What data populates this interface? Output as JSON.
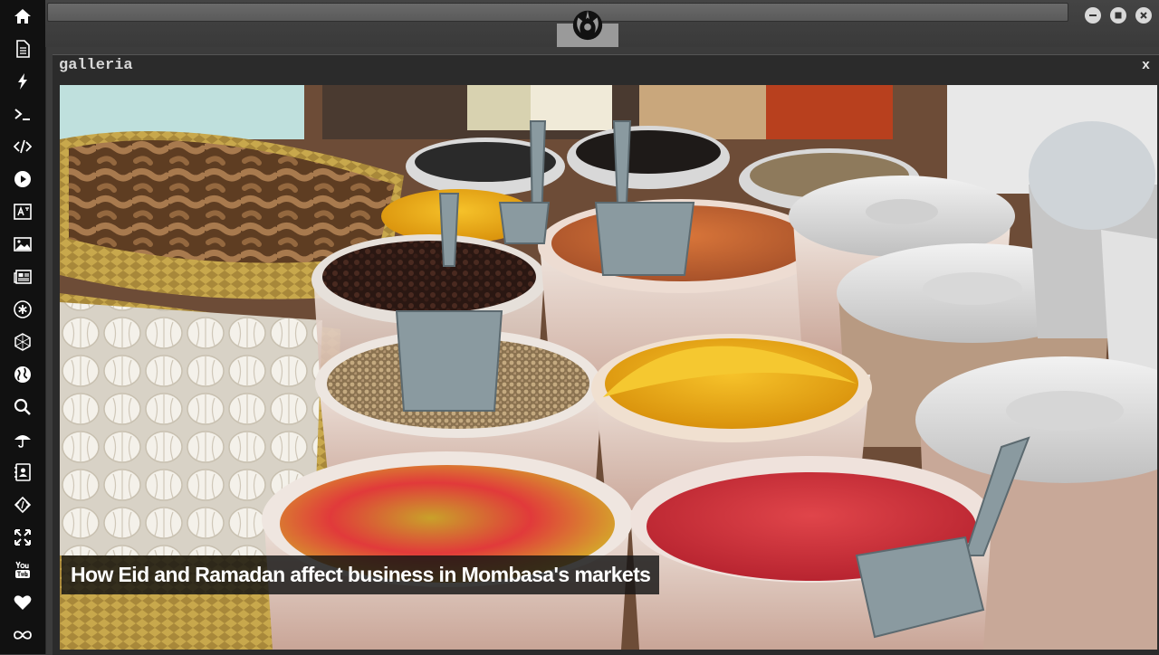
{
  "sidebar": {
    "items": [
      {
        "icon": "home-icon"
      },
      {
        "icon": "document-icon"
      },
      {
        "icon": "lightning-icon"
      },
      {
        "icon": "terminal-icon"
      },
      {
        "icon": "code-icon"
      },
      {
        "icon": "play-icon"
      },
      {
        "icon": "translate-icon"
      },
      {
        "icon": "image-icon"
      },
      {
        "icon": "newspaper-icon"
      },
      {
        "icon": "asterisk-icon"
      },
      {
        "icon": "hexagon-icon"
      },
      {
        "icon": "globe-icon"
      },
      {
        "icon": "search-icon"
      },
      {
        "icon": "umbrella-icon"
      },
      {
        "icon": "contact-card-icon"
      },
      {
        "icon": "codepen-icon"
      },
      {
        "icon": "fullscreen-icon"
      },
      {
        "icon": "youtube-icon"
      },
      {
        "icon": "heart-icon"
      },
      {
        "icon": "infinity-icon"
      }
    ]
  },
  "window": {
    "logo": "rebel-alliance-logo"
  },
  "gallery": {
    "title": "galleria",
    "close_label": "x",
    "caption": "How Eid and Ramadan affect business in Mombasa's markets"
  }
}
